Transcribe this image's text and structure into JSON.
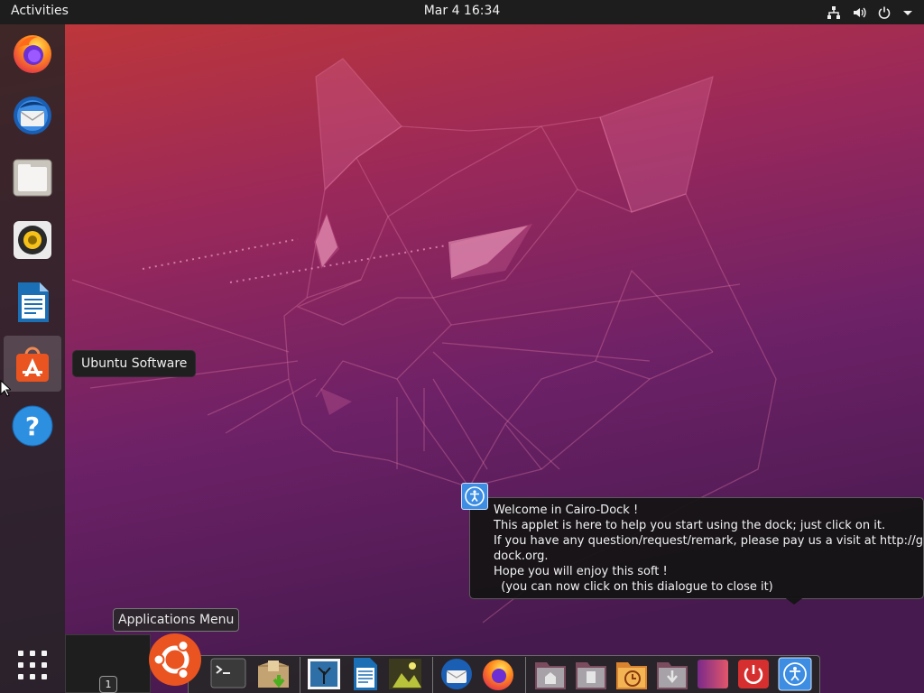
{
  "topbar": {
    "activities_label": "Activities",
    "clock": "Mar 4  16:34",
    "tray_icons": [
      "network-icon",
      "volume-icon",
      "power-icon",
      "chevron-down-icon"
    ]
  },
  "left_dock": {
    "items": [
      {
        "name": "Firefox",
        "icon": "firefox-icon"
      },
      {
        "name": "Thunderbird",
        "icon": "thunderbird-icon"
      },
      {
        "name": "Files",
        "icon": "files-icon"
      },
      {
        "name": "Rhythmbox",
        "icon": "rhythmbox-icon"
      },
      {
        "name": "LibreOffice Writer",
        "icon": "writer-icon"
      },
      {
        "name": "Ubuntu Software",
        "icon": "ubuntu-software-icon",
        "active": true
      },
      {
        "name": "Help",
        "icon": "help-icon"
      }
    ],
    "tooltip": "Ubuntu Software",
    "show_apps_icon": "grid-icon"
  },
  "cairo_dialog": {
    "lines": [
      "Welcome in Cairo-Dock !",
      "This applet is here to help you start using the dock; just click on it.",
      "If you have any question/request/remark, please pay us a visit at http://glx-",
      "dock.org.",
      "Hope you will enjoy this soft !",
      "  (you can now click on this dialogue to close it)"
    ],
    "icon": "accessibility-icon"
  },
  "applications_menu_label": "Applications Menu",
  "desk_switcher": {
    "current": "1"
  },
  "bottom_dock": {
    "items": [
      "ubuntu-logo-icon",
      "terminal-icon",
      "package-icon",
      "image-viewer-icon",
      "writer-icon",
      "image-icon",
      "thunderbird-icon",
      "firefox-icon",
      "home-folder-icon",
      "documents-folder-icon",
      "backup-icon",
      "downloads-folder-icon",
      "gradient-icon",
      "shutdown-icon",
      "accessibility-icon"
    ]
  },
  "colors": {
    "wallpaper_top": "#c63a35",
    "wallpaper_bottom": "#4a1a55",
    "topbar": "#1d1d1d",
    "accent_orange": "#e95420"
  }
}
